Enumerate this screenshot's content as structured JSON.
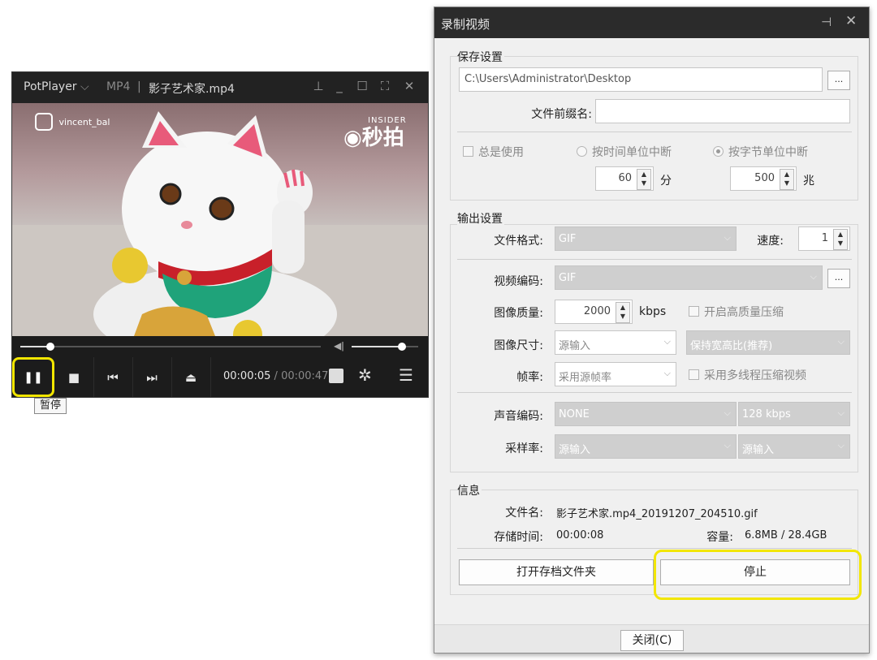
{
  "player": {
    "app_name": "PotPlayer",
    "format": "MP4",
    "filename": "影子艺术家.mp4",
    "watermark_user": "vincent_bal",
    "watermark_brand": "INSIDER",
    "watermark_logo": "秒拍",
    "time_current": "00:00:05",
    "time_separator": "/",
    "time_total": "00:00:47",
    "tooltip": "暂停",
    "seek_progress": 0.1,
    "volume_level": 0.75,
    "accent_highlight": "#f2e600"
  },
  "dialog": {
    "title": "录制视频",
    "save_group": "保存设置",
    "path_value": "C:\\Users\\Administrator\\Desktop",
    "browse_label": "...",
    "prefix_label": "文件前缀名:",
    "prefix_value": "",
    "always_use": "总是使用",
    "split_time": "按时间单位中断",
    "split_size": "按字节单位中断",
    "time_value": "60",
    "time_unit": "分",
    "size_value": "500",
    "size_unit": "兆",
    "output_group": "输出设置",
    "format_label": "文件格式:",
    "format_value": "GIF",
    "speed_label": "速度:",
    "speed_value": "1",
    "vcodec_label": "视频编码:",
    "vcodec_value": "GIF",
    "quality_label": "图像质量:",
    "quality_value": "2000",
    "quality_unit": "kbps",
    "hq_label": "开启高质量压缩",
    "size_label": "图像尺寸:",
    "size_value_combo": "源输入",
    "aspect_value": "保持宽高比(推荐)",
    "fps_label": "帧率:",
    "fps_value": "采用源帧率",
    "mt_label": "采用多线程压缩视频",
    "acodec_label": "声音编码:",
    "acodec_value": "NONE",
    "abitrate_value": "128 kbps",
    "samplerate_label": "采样率:",
    "samplerate_value": "源输入",
    "samplerate_value2": "源输入",
    "info_group": "信息",
    "file_label": "文件名:",
    "file_value": "影子艺术家.mp4_20191207_204510.gif",
    "stored_label": "存储时间:",
    "stored_value": "00:00:08",
    "capacity_label": "容量:",
    "capacity_value": "6.8MB / 28.4GB",
    "open_folder": "打开存档文件夹",
    "stop": "停止",
    "close": "关闭(C)"
  }
}
